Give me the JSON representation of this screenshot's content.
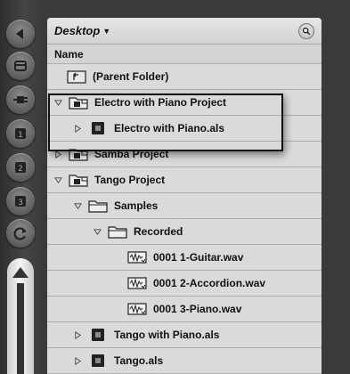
{
  "sidebar": {
    "buttons": [
      {
        "name": "back-icon"
      },
      {
        "name": "hide-icon"
      },
      {
        "name": "plugin-icon"
      },
      {
        "name": "places-1-icon"
      },
      {
        "name": "places-2-icon"
      },
      {
        "name": "places-3-icon"
      },
      {
        "name": "refresh-icon"
      }
    ]
  },
  "browser": {
    "location": "Desktop",
    "column_header": "Name",
    "rows": [
      {
        "label": "(Parent Folder)",
        "icon": "parent-folder-icon",
        "level": 0,
        "triangle": "none"
      },
      {
        "label": "Electro with Piano Project",
        "icon": "project-folder-icon",
        "level": 0,
        "triangle": "open"
      },
      {
        "label": "Electro with Piano.als",
        "icon": "live-set-icon",
        "level": 1,
        "triangle": "closed"
      },
      {
        "label": "Samba Project",
        "icon": "project-folder-icon",
        "level": 0,
        "triangle": "closed"
      },
      {
        "label": "Tango Project",
        "icon": "project-folder-icon",
        "level": 0,
        "triangle": "open"
      },
      {
        "label": "Samples",
        "icon": "folder-icon",
        "level": 1,
        "triangle": "open"
      },
      {
        "label": "Recorded",
        "icon": "folder-icon",
        "level": 2,
        "triangle": "open"
      },
      {
        "label": "0001 1-Guitar.wav",
        "icon": "audio-file-icon",
        "level": 3,
        "triangle": "none"
      },
      {
        "label": "0001 2-Accordion.wav",
        "icon": "audio-file-icon",
        "level": 3,
        "triangle": "none"
      },
      {
        "label": "0001 3-Piano.wav",
        "icon": "audio-file-icon",
        "level": 3,
        "triangle": "none"
      },
      {
        "label": "Tango with Piano.als",
        "icon": "live-set-icon",
        "level": 1,
        "triangle": "closed"
      },
      {
        "label": "Tango.als",
        "icon": "live-set-icon",
        "level": 1,
        "triangle": "closed"
      }
    ]
  },
  "colors": {
    "panel": "#d9d9d9",
    "row_border": "#ababab",
    "strip": "#3a3a3a"
  }
}
